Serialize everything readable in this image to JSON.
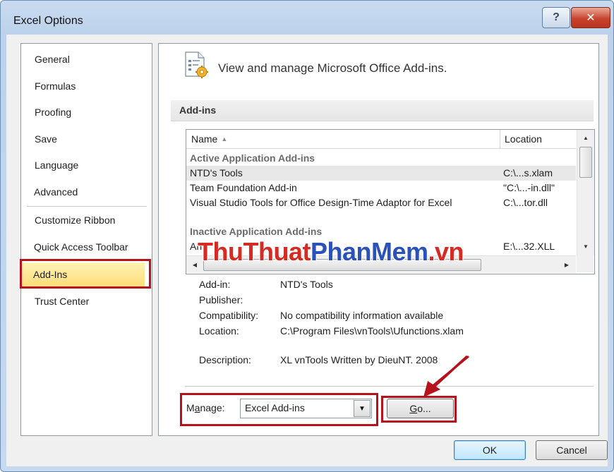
{
  "window": {
    "title": "Excel Options",
    "help_label": "?",
    "close_label": "✕"
  },
  "nav": {
    "items": [
      {
        "label": "General"
      },
      {
        "label": "Formulas"
      },
      {
        "label": "Proofing"
      },
      {
        "label": "Save"
      },
      {
        "label": "Language"
      },
      {
        "label": "Advanced"
      },
      {
        "label": "Customize Ribbon"
      },
      {
        "label": "Quick Access Toolbar"
      },
      {
        "label": "Add-Ins"
      },
      {
        "label": "Trust Center"
      }
    ],
    "selected": "Add-Ins"
  },
  "content": {
    "header": "View and manage Microsoft Office Add-ins.",
    "section_title": "Add-ins",
    "list": {
      "col_name": "Name",
      "col_location": "Location",
      "rows": [
        {
          "name": "Active Application Add-ins",
          "location": "",
          "type": "group"
        },
        {
          "name": "NTD's Tools",
          "location": "C:\\...s.xlam",
          "type": "selected"
        },
        {
          "name": "Team Foundation Add-in",
          "location": "\"C:\\...-in.dll\"",
          "type": "item"
        },
        {
          "name": "Visual Studio Tools for Office Design-Time Adaptor for Excel",
          "location": "C:\\...tor.dll",
          "type": "item"
        },
        {
          "name": "",
          "location": "",
          "type": "blank"
        },
        {
          "name": "Inactive Application Add-ins",
          "location": "",
          "type": "group"
        },
        {
          "name": "An",
          "location": "E:\\...32.XLL",
          "type": "item"
        }
      ]
    },
    "watermark": {
      "part1": "ThuThuat",
      "part2": "PhanMem",
      "part3": ".vn"
    },
    "details": {
      "addin_label": "Add-in:",
      "addin_value": "NTD's Tools",
      "publisher_label": "Publisher:",
      "publisher_value": "",
      "compat_label": "Compatibility:",
      "compat_value": "No compatibility information available",
      "location_label": "Location:",
      "location_value": "C:\\Program Files\\vnTools\\Ufunctions.xlam",
      "description_label": "Description:",
      "description_value": "XL vnTools Written by DieuNT. 2008"
    },
    "manage": {
      "label_prefix": "M",
      "label_accel": "a",
      "label_rest": "nage:",
      "value": "Excel Add-ins",
      "go_accel": "G",
      "go_rest": "o..."
    }
  },
  "footer": {
    "ok_label": "OK",
    "cancel_label": "Cancel"
  },
  "colors": {
    "highlight": "#b5121b",
    "selected_nav": "#fedc7a",
    "watermark_red": "#d52b22",
    "watermark_blue": "#2a52b8"
  }
}
